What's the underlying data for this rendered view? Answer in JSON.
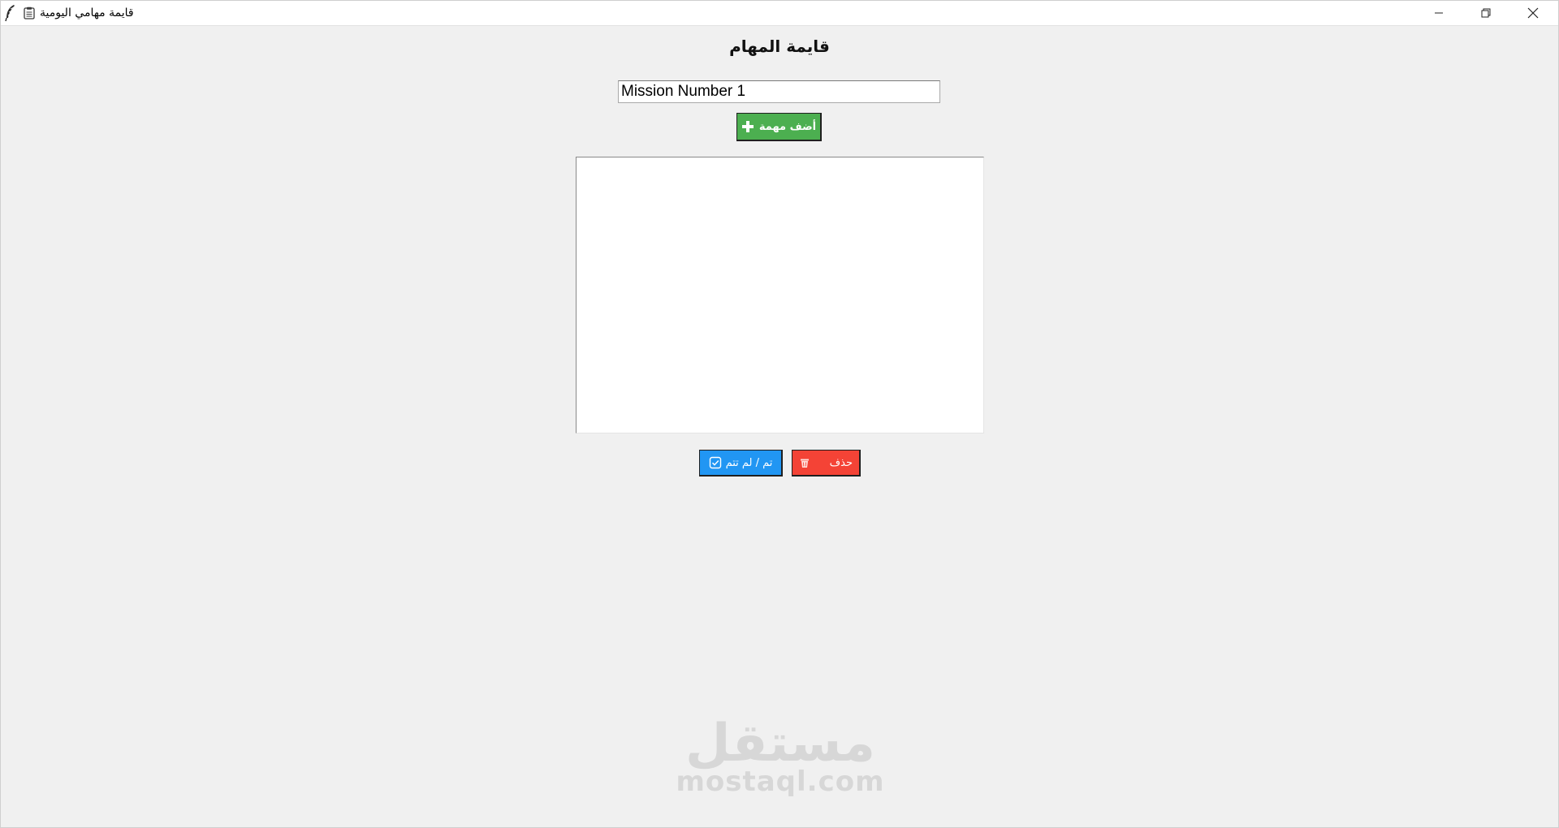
{
  "window": {
    "title": "قايمة مهامي اليومية",
    "app_icon": "feather-icon",
    "title_icon": "clipboard-icon",
    "controls": [
      "minimize-icon",
      "restore-icon",
      "close-icon"
    ]
  },
  "main": {
    "heading": "قايمة المهام",
    "task_input": {
      "value": "Mission Number 1",
      "placeholder": ""
    },
    "add_button": {
      "label": "أضف مهمة",
      "icon": "plus-icon"
    },
    "task_list": {
      "items": []
    },
    "toggle_button": {
      "label": "تم / لم تتم",
      "icon": "checkbox-icon"
    },
    "delete_button": {
      "label": "حذف",
      "icon": "trash-icon"
    }
  },
  "watermark": {
    "arabic": "مستقل",
    "latin": "mostaql.com"
  },
  "colors": {
    "add_button": "#4caf50",
    "toggle_button": "#2196f3",
    "delete_button": "#f44336",
    "background": "#f0f0f0",
    "watermark": "#d7d7d7"
  }
}
